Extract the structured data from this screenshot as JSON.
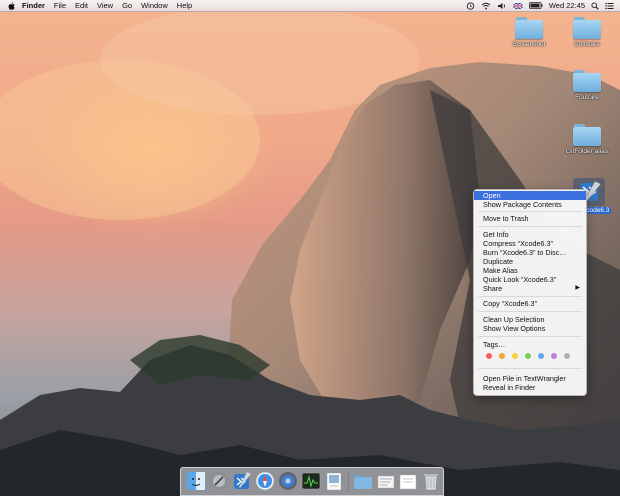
{
  "menubar": {
    "apple_icon": "apple-icon",
    "app_name": "Finder",
    "menus": [
      "File",
      "Edit",
      "View",
      "Go",
      "Window",
      "Help"
    ],
    "status_icons": [
      "time-machine-icon",
      "wifi-icon",
      "volume-icon",
      "flag-icon",
      "battery-icon"
    ],
    "clock": "Wed 22:45",
    "right_icons": [
      "spotlight-icon",
      "notification-center-icon"
    ]
  },
  "desktop": {
    "icons": [
      {
        "label": "Screenshot",
        "type": "folder"
      },
      {
        "label": "Software",
        "type": "folder"
      },
      {
        "label": "Foutoire",
        "type": "folder"
      },
      {
        "label": "GitFolder alias",
        "type": "folder-alias"
      }
    ],
    "selected_item": {
      "label": "Xcode6.3",
      "visible_label": "xcode6.3",
      "icon": "xcode-icon"
    }
  },
  "context_menu": {
    "items": [
      "Open",
      "Show Package Contents",
      "Move to Trash",
      "Get Info",
      "Compress “Xcode6.3”",
      "Burn “Xcode6.3” to Disc…",
      "Duplicate",
      "Make Alias",
      "Quick Look “Xcode6.3”",
      "Share",
      "Copy “Xcode6.3”",
      "Clean Up Selection",
      "Show View Options",
      "Tags…",
      "Open File in TextWrangler",
      "Reveal in Finder"
    ],
    "highlighted": "Open",
    "share_arrow": "▶",
    "tag_colors": [
      "#f45f5b",
      "#f6a33a",
      "#f4d33a",
      "#7ad34a",
      "#5aa8f0",
      "#c17be0",
      "#b0b0b0"
    ]
  },
  "dock": {
    "items": [
      "finder-icon",
      "launchpad-icon",
      "xcode-icon",
      "safari-icon",
      "system-preferences-icon",
      "activity-monitor-icon",
      "preview-icon",
      "documents-folder-icon",
      "applications-stack-icon",
      "downloads-stack-icon",
      "trash-icon"
    ]
  },
  "colors": {
    "menu_highlight": "#3e6fde",
    "folder_blue": "#6eaedc"
  }
}
